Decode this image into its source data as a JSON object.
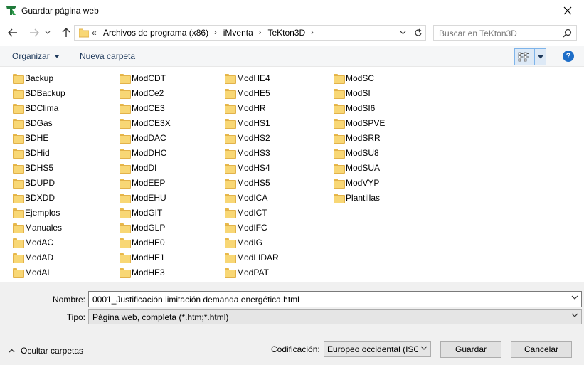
{
  "window": {
    "title": "Guardar página web"
  },
  "address": {
    "crumbs": [
      "Archivos de programa (x86)",
      "iMventa",
      "TeKton3D"
    ],
    "overflow": "«"
  },
  "search": {
    "placeholder": "Buscar en TeKton3D"
  },
  "toolbar": {
    "organize_label": "Organizar",
    "new_folder_label": "Nueva carpeta",
    "help_label": "?"
  },
  "folders": {
    "col1": [
      "Backup",
      "BDBackup",
      "BDClima",
      "BDGas",
      "BDHE",
      "BDHid",
      "BDHS5",
      "BDUPD",
      "BDXDD",
      "Ejemplos",
      "Manuales",
      "ModAC",
      "ModAD",
      "ModAL"
    ],
    "col2": [
      "ModCDT",
      "ModCe2",
      "ModCE3",
      "ModCE3X",
      "ModDAC",
      "ModDHC",
      "ModDI",
      "ModEEP",
      "ModEHU",
      "ModGIT",
      "ModGLP",
      "ModHE0",
      "ModHE1",
      "ModHE3"
    ],
    "col3": [
      "ModHE4",
      "ModHE5",
      "ModHR",
      "ModHS1",
      "ModHS2",
      "ModHS3",
      "ModHS4",
      "ModHS5",
      "ModICA",
      "ModICT",
      "ModIFC",
      "ModIG",
      "ModLIDAR",
      "ModPAT"
    ],
    "col4": [
      "ModSC",
      "ModSI",
      "ModSI6",
      "ModSPVE",
      "ModSRR",
      "ModSU8",
      "ModSUA",
      "ModVYP",
      "Plantillas"
    ]
  },
  "form": {
    "name_label": "Nombre:",
    "name_value": "0001_Justificación limitación demanda energética.html",
    "type_label": "Tipo:",
    "type_value": "Página web, completa (*.htm;*.html)"
  },
  "footer": {
    "hide_folders_label": "Ocultar carpetas",
    "encoding_label": "Codificación:",
    "encoding_value": "Europeo occidental (ISO",
    "save_label": "Guardar",
    "cancel_label": "Cancelar"
  },
  "colors": {
    "accent": "#1e6ec8",
    "folder": "#f8d775",
    "toolbar_bg": "#f5f6f7",
    "footer_bg": "#f0f0f0"
  }
}
